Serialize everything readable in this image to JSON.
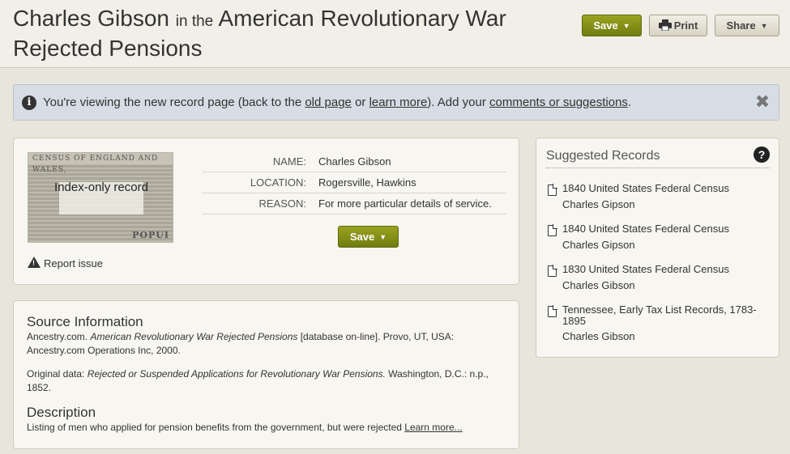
{
  "header": {
    "name": "Charles Gibson",
    "connector": "in the",
    "collection": "American Revolutionary War Rejected Pensions",
    "save_label": "Save",
    "print_label": "Print",
    "share_label": "Share"
  },
  "notice": {
    "text_1": "You're viewing the new record page (back to the ",
    "old_page_link": "old page",
    "text_2": " or ",
    "learn_more_link": "learn more",
    "text_3": "). Add your ",
    "comments_link": "comments or suggestions",
    "text_4": "."
  },
  "record": {
    "thumb_top_text": "CENSUS OF ENGLAND AND WALES,",
    "thumb_bottom_text": "POPUI",
    "thumb_overlay": "Index-only record",
    "fields": [
      {
        "label": "NAME:",
        "value": "Charles Gibson"
      },
      {
        "label": "LOCATION:",
        "value": "Rogersville, Hawkins"
      },
      {
        "label": "REASON:",
        "value": "For more particular details of service."
      }
    ],
    "save_label": "Save",
    "report_label": "Report issue"
  },
  "source": {
    "heading": "Source Information",
    "citation_1": "Ancestry.com. ",
    "citation_title": "American Revolutionary War Rejected Pensions",
    "citation_2": " [database on-line]. Provo, UT, USA: Ancestry.com Operations Inc, 2000.",
    "original_1": "Original data: ",
    "original_title": "Rejected or Suspended Applications for Revolutionary War Pensions.",
    "original_2": " Washington, D.C.: n.p., 1852.",
    "description_heading": "Description",
    "description_text": "Listing of men who applied for pension benefits from the government, but were rejected ",
    "description_link": "Learn more..."
  },
  "suggested": {
    "title": "Suggested Records",
    "items": [
      {
        "collection": "1840 United States Federal Census",
        "name": "Charles Gipson"
      },
      {
        "collection": "1840 United States Federal Census",
        "name": "Charles Gipson"
      },
      {
        "collection": "1830 United States Federal Census",
        "name": "Charles Gibson"
      },
      {
        "collection": "Tennessee, Early Tax List Records, 1783-1895",
        "name": "Charles Gibson"
      }
    ]
  }
}
